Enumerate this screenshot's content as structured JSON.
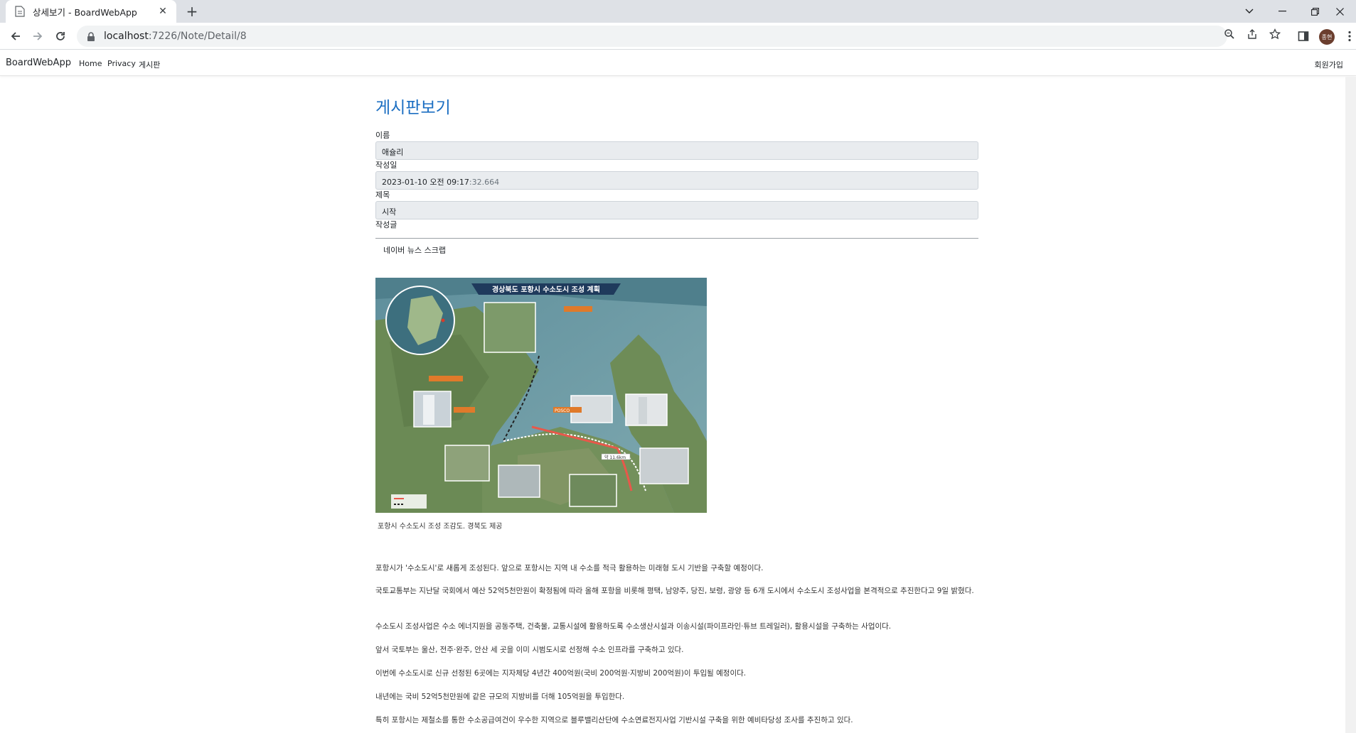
{
  "browser": {
    "tab_title": "상세보기 - BoardWebApp",
    "url_host": "localhost",
    "url_path": ":7226/Note/Detail/8",
    "profile_initials": "종현"
  },
  "navbar": {
    "brand": "BoardWebApp",
    "links": [
      "Home",
      "Privacy",
      "게시판"
    ],
    "signup": "회원가입"
  },
  "page": {
    "title": "게시판보기",
    "fields": {
      "name_label": "이름",
      "name_value": "애슐리",
      "date_label": "작성일",
      "date_value": "2023-01-10 오전 09:17",
      "date_ms": ":32.664",
      "subject_label": "제목",
      "subject_value": "시작",
      "content_label": "작성글"
    },
    "article": {
      "heading": "네이버 뉴스 스크랩",
      "image": {
        "map_title": "경상북도 포항시 수소도시 조성 계획",
        "tags": [
          "POSCO",
          "약 11.6km"
        ]
      },
      "caption": "포항시 수소도시 조성 조감도. 경북도 제공",
      "paragraphs": [
        "포항시가 '수소도시'로 새롭게 조성된다. 앞으로 포항시는 지역 내 수소를 적극 활용하는 미래형 도시 기반을 구축할 예정이다.",
        "국토교통부는 지난달 국회에서 예산 52억5천만원이 확정됨에 따라 올해 포항을 비롯해 평택, 남양주, 당진, 보령, 광양 등 6개 도시에서 수소도시 조성사업을 본격적으로 추진한다고 9일 밝혔다.",
        "수소도시 조성사업은 수소 에너지원을 공동주택, 건축물, 교통시설에 활용하도록 수소생산시설과 이송시설(파이프라인·튜브 트레일러), 활용시설을 구축하는 사업이다.",
        "앞서 국토부는 울산, 전주·완주, 안산 세 곳을 이미 시범도시로 선정해 수소 인프라를 구축하고 있다.",
        "이번에 수소도시로 신규 선정된 6곳에는 지자체당 4년간 400억원(국비 200억원·지방비 200억원)이 투입될 예정이다.",
        "내년에는 국비 52억5천만원에 같은 규모의 지방비를 더해 105억원을 투입한다.",
        "특히 포항시는 제철소를 통한 수소공급여건이 우수한 지역으로 블루밸리산단에 수소연료전지사업 기반시설 구축을 위한 예비타당성 조사를 추진하고 있다."
      ]
    }
  },
  "colors": {
    "accent": "#1b6ec2",
    "field_bg": "#e9ecef",
    "tabstrip": "#dee1e6"
  }
}
